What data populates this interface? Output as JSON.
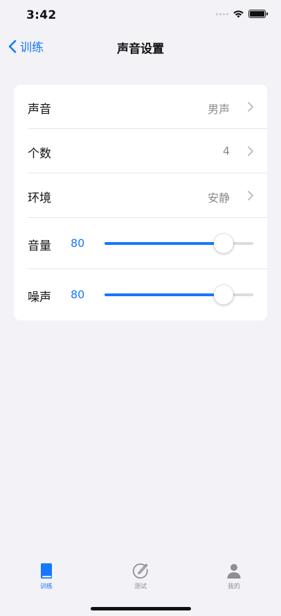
{
  "status_bar": {
    "time": "3:42"
  },
  "nav": {
    "back_label": "训练",
    "title": "声音设置"
  },
  "settings": {
    "rows": [
      {
        "label": "声音",
        "value": "男声"
      },
      {
        "label": "个数",
        "value": "4"
      },
      {
        "label": "环境",
        "value": "安静"
      }
    ],
    "sliders": [
      {
        "label": "音量",
        "value": "80",
        "level": 0.8
      },
      {
        "label": "噪声",
        "value": "80",
        "level": 0.8
      }
    ]
  },
  "tabs": [
    {
      "label": "训练",
      "icon": "book-icon",
      "active": true
    },
    {
      "label": "测试",
      "icon": "pencil-circle-icon",
      "active": false
    },
    {
      "label": "我的",
      "icon": "person-icon",
      "active": false
    }
  ],
  "colors": {
    "accent": "#1677ff",
    "background": "#f2f2f7",
    "card": "#ffffff",
    "secondary_text": "#8a8a8e"
  }
}
